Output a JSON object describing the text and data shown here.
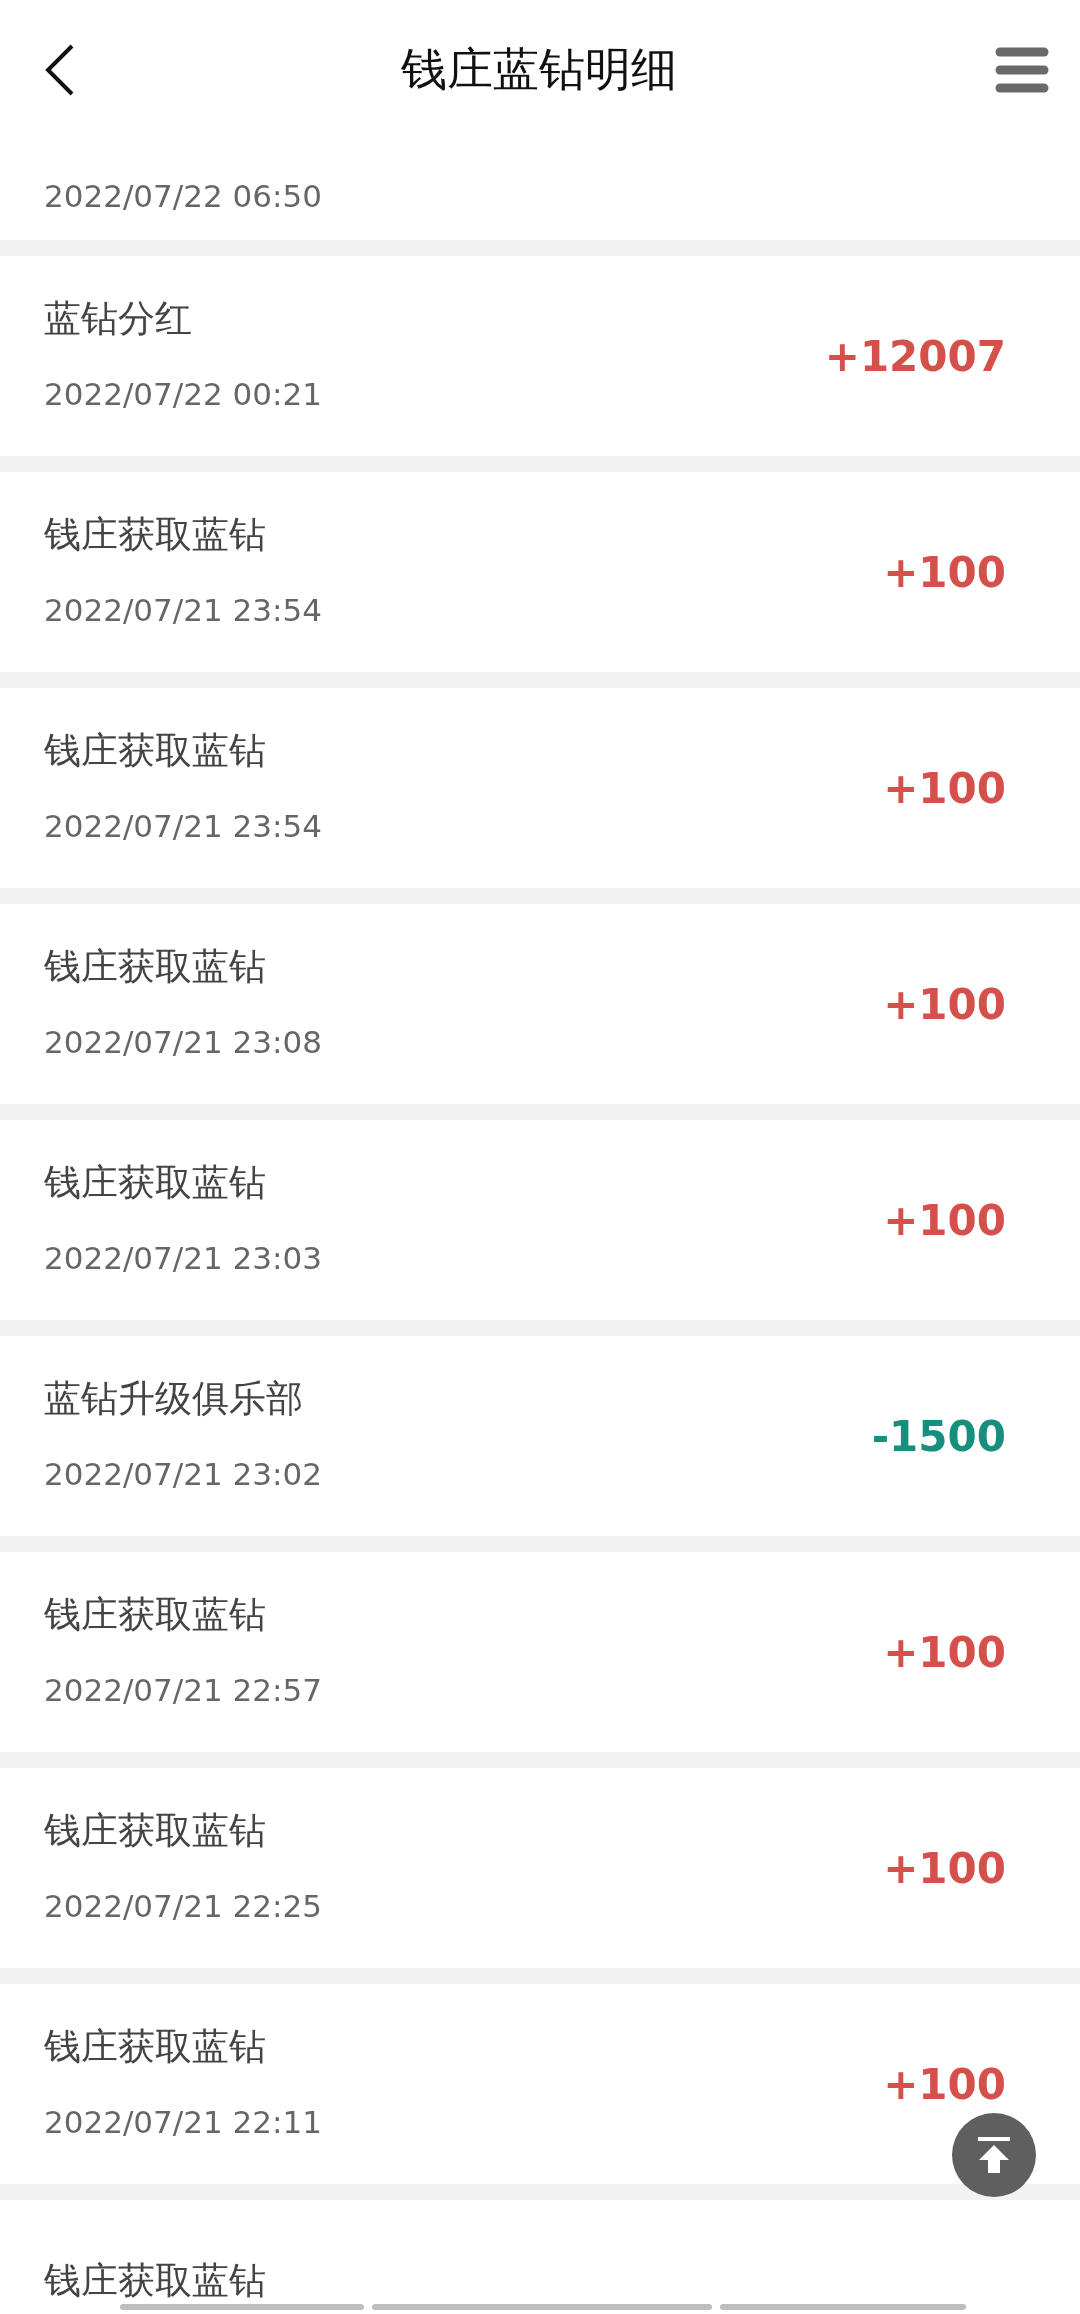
{
  "header": {
    "title": "钱庄蓝钻明细"
  },
  "top_partial_row": {
    "date": "2022/07/22 06:50"
  },
  "rows": [
    {
      "title": "蓝钻分红",
      "date": "2022/07/22 00:21",
      "amount": "+12007",
      "kind": "credit"
    },
    {
      "title": "钱庄获取蓝钻",
      "date": "2022/07/21 23:54",
      "amount": "+100",
      "kind": "credit"
    },
    {
      "title": "钱庄获取蓝钻",
      "date": "2022/07/21 23:54",
      "amount": "+100",
      "kind": "credit"
    },
    {
      "title": "钱庄获取蓝钻",
      "date": "2022/07/21 23:08",
      "amount": "+100",
      "kind": "credit"
    },
    {
      "title": "钱庄获取蓝钻",
      "date": "2022/07/21 23:03",
      "amount": "+100",
      "kind": "credit"
    },
    {
      "title": "蓝钻升级俱乐部",
      "date": "2022/07/21 23:02",
      "amount": "-1500",
      "kind": "debit"
    },
    {
      "title": "钱庄获取蓝钻",
      "date": "2022/07/21 22:57",
      "amount": "+100",
      "kind": "credit"
    },
    {
      "title": "钱庄获取蓝钻",
      "date": "2022/07/21 22:25",
      "amount": "+100",
      "kind": "credit"
    },
    {
      "title": "钱庄获取蓝钻",
      "date": "2022/07/21 22:11",
      "amount": "+100",
      "kind": "credit"
    }
  ],
  "bottom_partial_row": {
    "title": "钱庄获取蓝钻"
  }
}
